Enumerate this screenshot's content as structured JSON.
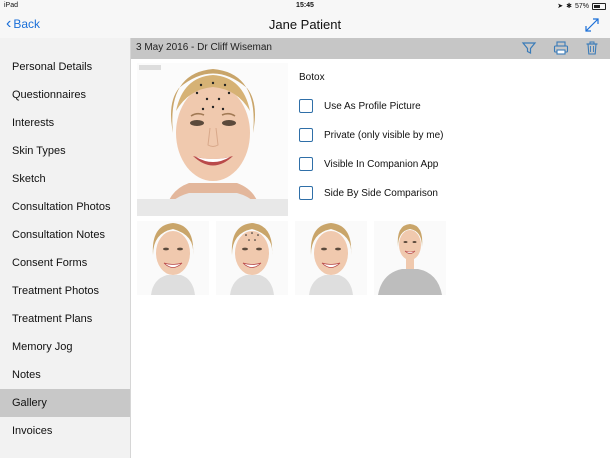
{
  "status_bar": {
    "device": "iPad",
    "time": "15:45",
    "battery": "57%"
  },
  "nav": {
    "back_label": "Back",
    "title": "Jane Patient"
  },
  "sidebar": {
    "items": [
      {
        "label": "Personal Details"
      },
      {
        "label": "Questionnaires"
      },
      {
        "label": "Interests"
      },
      {
        "label": "Skin Types"
      },
      {
        "label": "Sketch"
      },
      {
        "label": "Consultation Photos"
      },
      {
        "label": "Consultation Notes"
      },
      {
        "label": "Consent Forms"
      },
      {
        "label": "Treatment Photos"
      },
      {
        "label": "Treatment Plans"
      },
      {
        "label": "Memory Jog"
      },
      {
        "label": "Notes"
      },
      {
        "label": "Gallery",
        "active": true
      },
      {
        "label": "Invoices"
      }
    ]
  },
  "content": {
    "header": "3 May 2016 - Dr Cliff Wiseman",
    "treatment_label": "Botox",
    "options": [
      {
        "label": "Use As Profile Picture",
        "checked": false
      },
      {
        "label": "Private (only visible by me)",
        "checked": false
      },
      {
        "label": "Visible In Companion App",
        "checked": false
      },
      {
        "label": "Side By Side Comparison",
        "checked": false
      }
    ]
  },
  "icons": {
    "back": "chevron-left-icon",
    "expand": "expand-icon",
    "filter": "filter-icon",
    "print": "printer-icon",
    "delete": "trash-icon"
  },
  "colors": {
    "accent": "#1a6fd8",
    "checkbox": "#2f6fa8",
    "header_bar": "#c6c6c6",
    "active_item": "#c8c8c8"
  }
}
